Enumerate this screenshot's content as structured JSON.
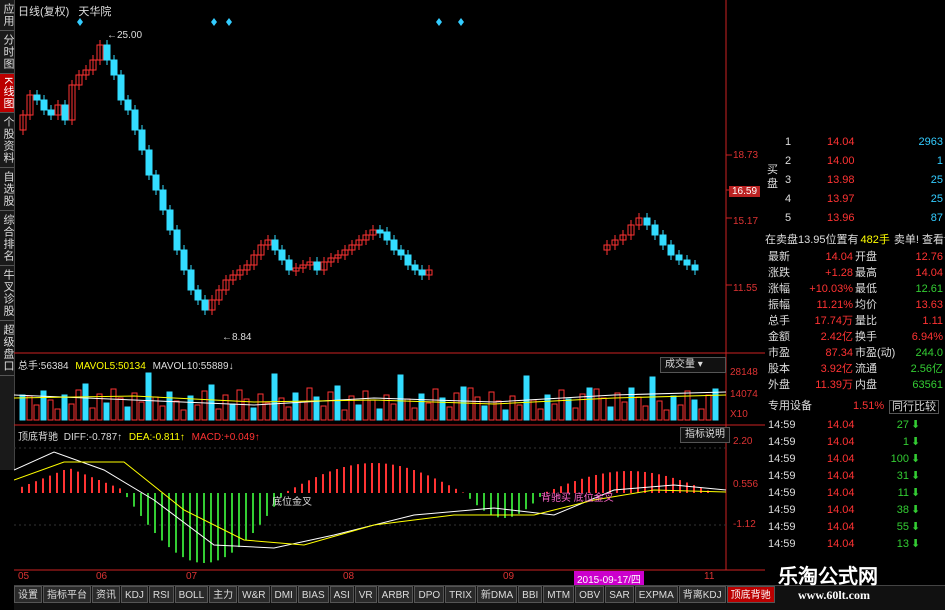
{
  "header": {
    "title": "日线(复权)",
    "stock": "天华院"
  },
  "side_tabs": [
    "应用",
    "分时图",
    "K线图",
    "个股资料",
    "自选股",
    "综合排名",
    "牛叉诊股",
    "超级盘口"
  ],
  "side_tabs_active": 2,
  "price_axis": {
    "labels": [
      "18.73",
      "16.59",
      "15.17",
      "11.55"
    ],
    "highlight": "16.59"
  },
  "price_annotations": {
    "high": "25.00",
    "low": "8.84"
  },
  "volume_panel": {
    "label_total": "总手:",
    "total": "56384",
    "mavol5_label": "MAVOL5:",
    "mavol5": "50134",
    "mavol10_label": "MAVOL10:",
    "mavol10": "55889",
    "button": "成交量",
    "axis": [
      "28148",
      "14074",
      "X10"
    ]
  },
  "macd_panel": {
    "name": "顶底背驰",
    "diff_label": "DIFF:",
    "diff": "-0.787",
    "dea_label": "DEA:",
    "dea": "-0.811",
    "macd_label": "MACD:",
    "macd": "+0.049",
    "button": "指标说明",
    "axis": [
      "2.20",
      "0.556",
      "-1.12"
    ],
    "annotation_left": "底位金叉",
    "annotation_right": "背驰买 底位金叉"
  },
  "time_axis": {
    "labels": [
      "05",
      "06",
      "07",
      "08",
      "09",
      "10",
      "11"
    ],
    "cursor_date": "2015-09-17/四"
  },
  "order_book": [
    {
      "level": "1",
      "price": "14.04",
      "vol": "2963"
    },
    {
      "level": "2",
      "price": "14.00",
      "vol": "1"
    },
    {
      "level": "3",
      "price": "13.98",
      "vol": "25"
    },
    {
      "level": "4",
      "price": "13.97",
      "vol": "25"
    },
    {
      "level": "5",
      "price": "13.96",
      "vol": "87"
    }
  ],
  "order_book_side": "买盘",
  "notice": {
    "text": "在卖盘13.95位置有",
    "count": "482手",
    "link": "卖单! 查看详细"
  },
  "quote": [
    {
      "k1": "最新",
      "v1": "14.04",
      "k2": "开盘",
      "v2": "12.76"
    },
    {
      "k1": "涨跌",
      "v1": "+1.28",
      "k2": "最高",
      "v2": "14.04"
    },
    {
      "k1": "涨幅",
      "v1": "+10.03%",
      "k2": "最低",
      "v2": "12.61"
    },
    {
      "k1": "振幅",
      "v1": "11.21%",
      "k2": "均价",
      "v2": "13.63"
    },
    {
      "k1": "总手",
      "v1": "17.74万",
      "k2": "量比",
      "v2": "1.11"
    },
    {
      "k1": "金额",
      "v1": "2.42亿",
      "k2": "换手",
      "v2": "6.94%"
    },
    {
      "k1": "市盈",
      "v1": "87.34",
      "k2": "市盈(动)",
      "v2": "244.0"
    },
    {
      "k1": "股本",
      "v1": "3.92亿",
      "k2": "流通",
      "v2": "2.56亿"
    },
    {
      "k1": "外盘",
      "v1": "11.39万",
      "k2": "内盘",
      "v2": "63561"
    }
  ],
  "sector": {
    "label": "专用设备",
    "pct": "1.51%",
    "button": "同行比较"
  },
  "ticks": [
    {
      "time": "14:59",
      "price": "14.04",
      "vol": "27"
    },
    {
      "time": "14:59",
      "price": "14.04",
      "vol": "1"
    },
    {
      "time": "14:59",
      "price": "14.04",
      "vol": "100"
    },
    {
      "time": "14:59",
      "price": "14.04",
      "vol": "31"
    },
    {
      "time": "14:59",
      "price": "14.04",
      "vol": "11"
    },
    {
      "time": "14:59",
      "price": "14.04",
      "vol": "38"
    },
    {
      "time": "14:59",
      "price": "14.04",
      "vol": "55"
    },
    {
      "time": "14:59",
      "price": "14.04",
      "vol": "13"
    }
  ],
  "bottom_tabs": [
    "设置",
    "指标平台",
    "资讯",
    "KDJ",
    "RSI",
    "BOLL",
    "主力",
    "W&R",
    "DMI",
    "BIAS",
    "ASI",
    "VR",
    "ARBR",
    "DPO",
    "TRIX",
    "新DMA",
    "BBI",
    "MTM",
    "OBV",
    "SAR",
    "EXPMA",
    "背离KDJ",
    "顶底背驰"
  ],
  "bottom_active": 22,
  "watermark": {
    "cn": "乐淘公式网",
    "url": "www.60lt.com"
  },
  "colors": {
    "up": "#ff3333",
    "down": "#33ddff",
    "bg": "#000000",
    "axis_red": "#cc2222"
  }
}
